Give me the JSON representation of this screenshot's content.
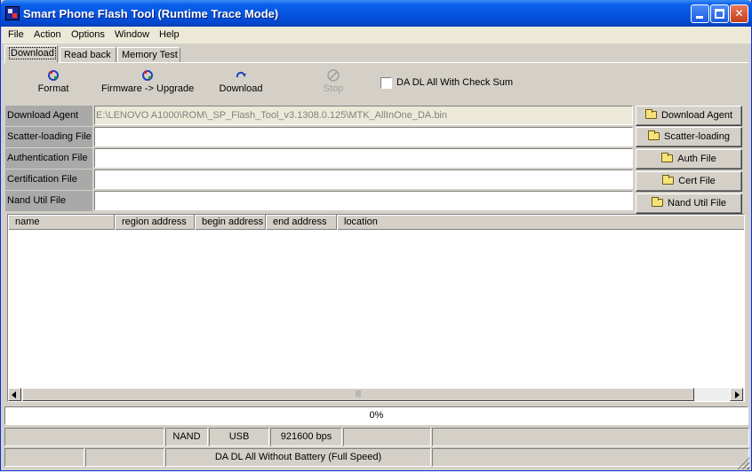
{
  "window": {
    "title": "Smart Phone Flash Tool (Runtime Trace Mode)",
    "controls": [
      "minimize",
      "maximize",
      "close"
    ]
  },
  "menu": {
    "items": [
      {
        "label": "File"
      },
      {
        "label": "Action"
      },
      {
        "label": "Options"
      },
      {
        "label": "Window"
      },
      {
        "label": "Help"
      }
    ]
  },
  "tabs": [
    {
      "label": "Download",
      "active": true
    },
    {
      "label": "Read back",
      "active": false
    },
    {
      "label": "Memory Test",
      "active": false
    }
  ],
  "toolbar": {
    "format_label": "Format",
    "upgrade_label": "Firmware -> Upgrade",
    "download_label": "Download",
    "stop_label": "Stop",
    "checksum_label": "DA DL All With Check Sum",
    "checksum_checked": false
  },
  "files": [
    {
      "label": "Download Agent",
      "value": "E:\\LENOVO A1000\\ROM\\_SP_Flash_Tool_v3.1308.0.125\\MTK_AllInOne_DA.bin",
      "button": "Download Agent"
    },
    {
      "label": "Scatter-loading File",
      "value": "",
      "button": "Scatter-loading"
    },
    {
      "label": "Authentication File",
      "value": "",
      "button": "Auth File"
    },
    {
      "label": "Certification File",
      "value": "",
      "button": "Cert File"
    },
    {
      "label": "Nand Util File",
      "value": "",
      "button": "Nand Util File"
    }
  ],
  "table": {
    "columns": [
      "name",
      "region address",
      "begin address",
      "end address",
      "location"
    ],
    "rows": []
  },
  "progress": {
    "text": "0%",
    "value": 0
  },
  "status": {
    "row1": [
      "",
      "NAND",
      "USB",
      "921600 bps",
      "",
      ""
    ],
    "row2": [
      "",
      "",
      "DA DL All Without Battery (Full Speed)",
      ""
    ]
  },
  "colors": {
    "titlebar": "#0656e2",
    "face": "#d4d0c8",
    "label_bg": "#a9a9a9"
  },
  "icons": {
    "format": "format-icon",
    "upgrade": "upgrade-icon",
    "download": "download-icon",
    "stop": "stop-icon",
    "folder": "folder-icon"
  }
}
